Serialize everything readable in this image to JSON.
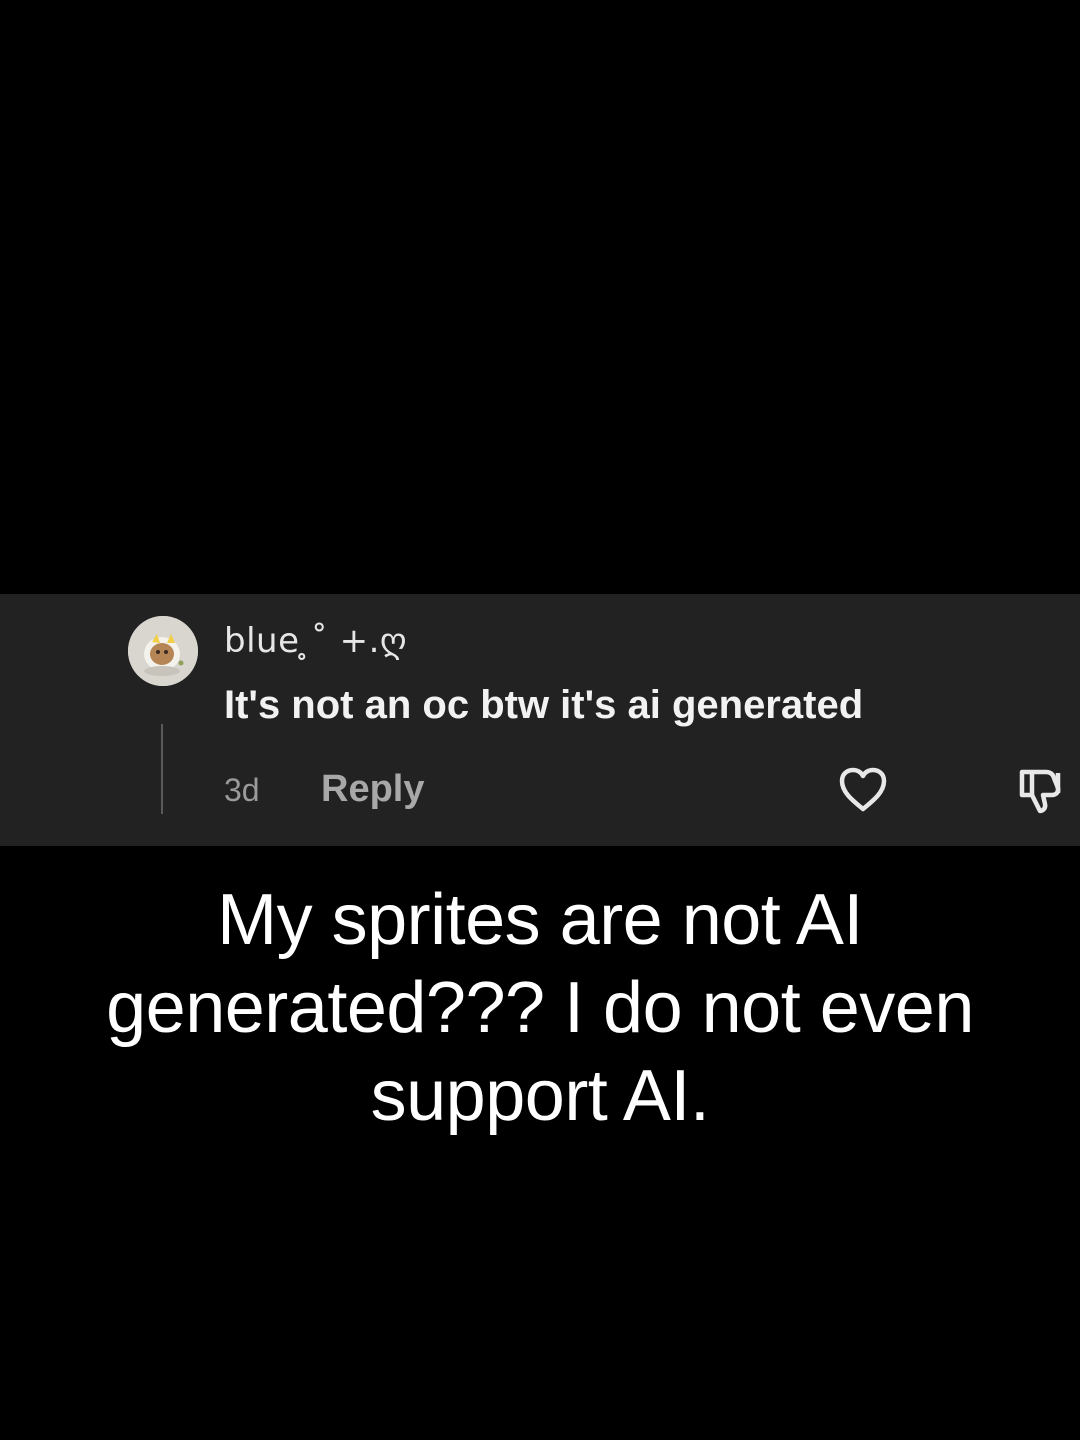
{
  "comment": {
    "username": "blue ̥˚ +.ღ",
    "text": "It's not an oc btw it's ai generated",
    "time": "3d",
    "reply_label": "Reply",
    "like_icon": "heart-outline-icon",
    "dislike_icon": "thumbs-down-outline-icon"
  },
  "caption": {
    "text": "My sprites are not AI generated??? I do not even support AI."
  },
  "colors": {
    "background": "#000000",
    "comment_card": "#222222",
    "primary_text": "#f2f2f2",
    "secondary_text": "#9a9a9a"
  }
}
